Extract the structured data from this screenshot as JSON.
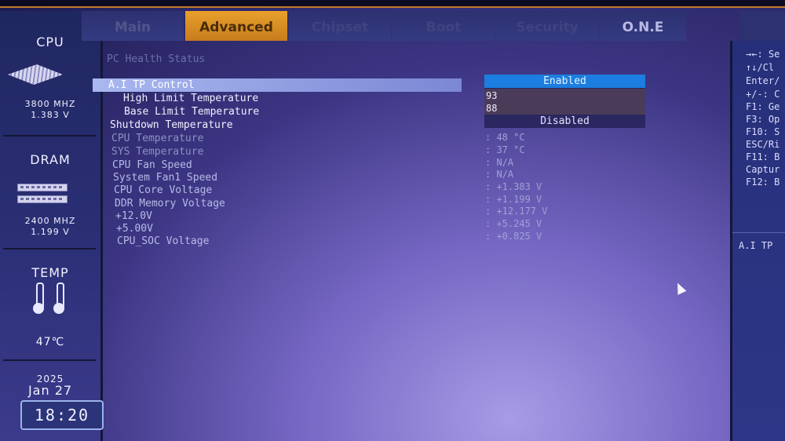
{
  "sidebar": {
    "cpu_title": "CPU",
    "cpu_freq": "3800 MHZ",
    "cpu_volt": "1.383 V",
    "dram_title": "DRAM",
    "dram_freq": "2400 MHZ",
    "dram_volt": "1.199 V",
    "temp_title": "TEMP",
    "temp_value": "47℃",
    "year": "2025",
    "date": "Jan 27",
    "time": "18:20"
  },
  "tabs": [
    {
      "label": "Main"
    },
    {
      "label": "Advanced"
    },
    {
      "label": "Chipset"
    },
    {
      "label": "Boot"
    },
    {
      "label": "Security"
    },
    {
      "label": "O.N.E"
    }
  ],
  "section_title": "PC Health Status",
  "items": [
    {
      "label": "A.I TP Control"
    },
    {
      "label": "High Limit Temperature"
    },
    {
      "label": "Base Limit Temperature"
    },
    {
      "label": "Shutdown Temperature"
    },
    {
      "label": "CPU Temperature",
      "value": ": 48 °C"
    },
    {
      "label": "SYS Temperature",
      "value": ": 37 °C"
    },
    {
      "label": "CPU Fan Speed",
      "value": ": N/A"
    },
    {
      "label": "System Fan1 Speed",
      "value": ": N/A"
    },
    {
      "label": "CPU Core Voltage",
      "value": ": +1.383 V"
    },
    {
      "label": "DDR Memory Voltage",
      "value": ": +1.199 V"
    },
    {
      "label": "+12.0V",
      "value": ": +12.177 V"
    },
    {
      "label": "+5.00V",
      "value": ": +5.245 V"
    },
    {
      "label": "CPU_SOC Voltage",
      "value": ": +0.825 V"
    }
  ],
  "dropdown": {
    "enabled": "Enabled",
    "high_value": "93",
    "base_value": "88",
    "disabled": "Disabled"
  },
  "help": {
    "lines": [
      "→←: Se",
      "↑↓/Cl",
      "Enter/",
      "+/-: C",
      "F1: Ge",
      "F3: Op",
      "F10: S",
      "ESC/Ri",
      "F11: B",
      "Captur",
      "F12: B"
    ],
    "description": "A.I TP"
  }
}
